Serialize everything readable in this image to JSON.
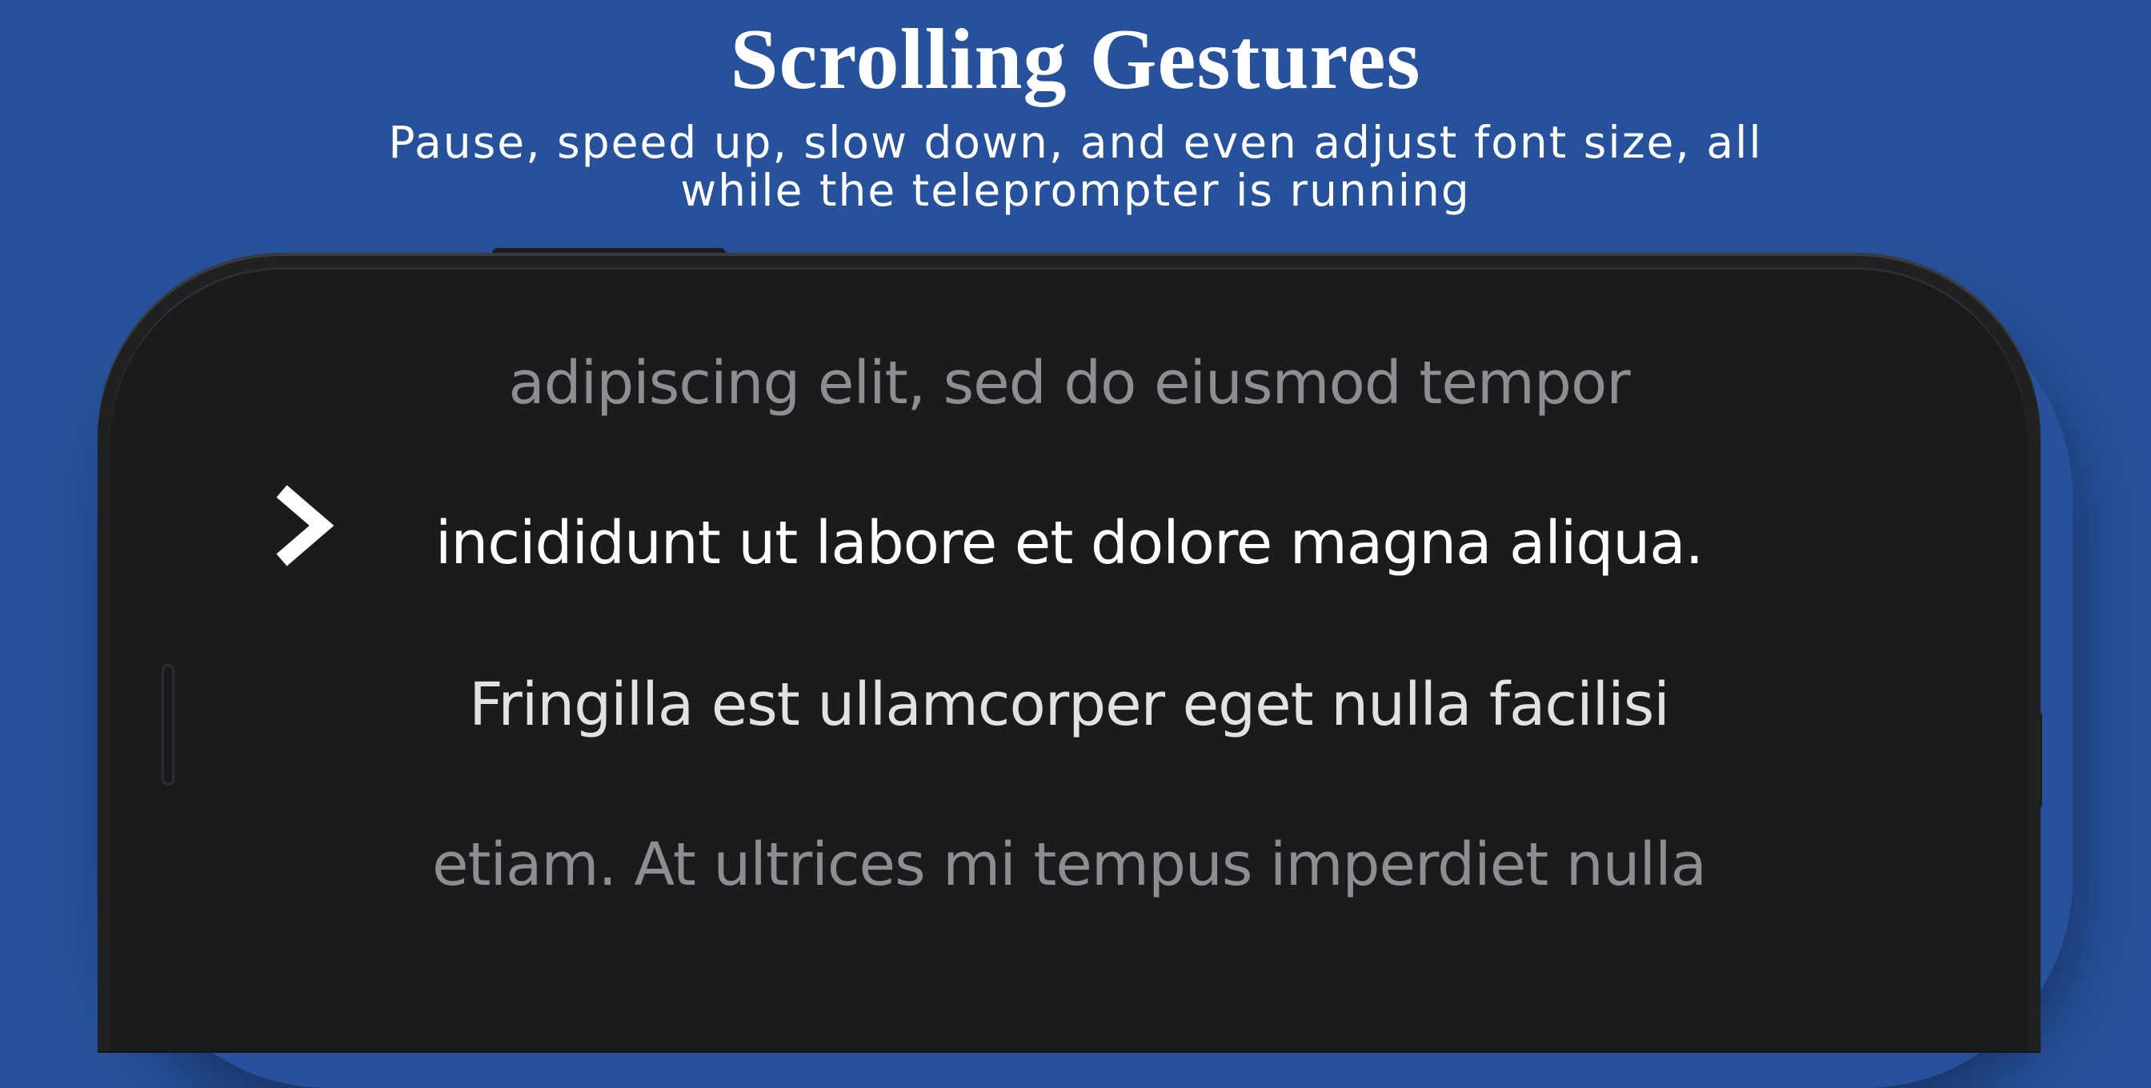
{
  "header": {
    "title": "Scrolling Gestures",
    "subtitle_line1": "Pause, speed up, slow down, and even adjust font size, all",
    "subtitle_line2": "while the teleprompter is running"
  },
  "teleprompter": {
    "lines": [
      "adipiscing elit, sed do eiusmod tempor",
      "incididunt ut labore et dolore magna aliqua.",
      "Fringilla est ullamcorper eget nulla facilisi",
      "etiam. At ultrices mi tempus imperdiet nulla"
    ],
    "current_line_index": 1,
    "cursor_icon": "chevron-right-icon"
  },
  "colors": {
    "background": "#27529b",
    "screen": "#1b1b1d",
    "active_text": "#ffffff",
    "dim_text": "#8d8d92"
  }
}
